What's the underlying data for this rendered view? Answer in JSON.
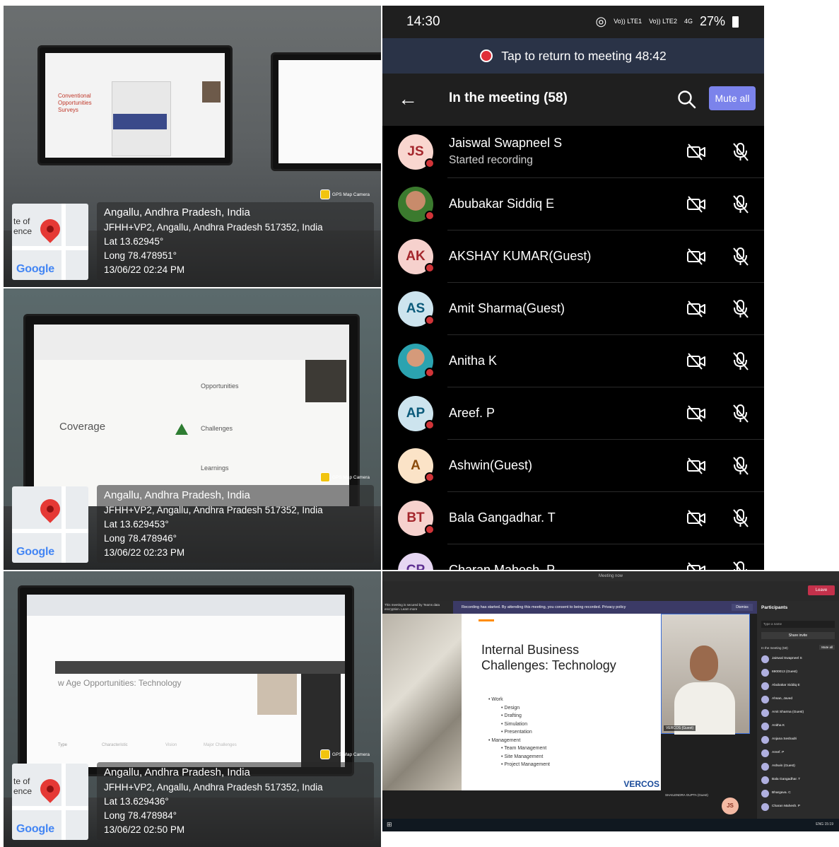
{
  "photos": [
    {
      "map_label_lines": [
        "te of",
        "ence"
      ],
      "map_brand": "Google",
      "gps_tag": "GPS Map Camera",
      "place": "Angallu, Andhra Pradesh, India",
      "address": "JFHH+VP2, Angallu, Andhra Pradesh 517352, India",
      "lat": "Lat 13.62945°",
      "long": "Long 78.478951°",
      "datetime": "13/06/22 02:24 PM",
      "screen_texts": [
        "Conventional",
        "Opportunities",
        "Surveys"
      ]
    },
    {
      "map_label_lines": [
        "",
        ""
      ],
      "map_brand": "Google",
      "gps_tag": "GPS Map Camera",
      "place": "Angallu, Andhra Pradesh, India",
      "address": "JFHH+VP2, Angallu, Andhra Pradesh 517352, India",
      "lat": "Lat 13.629453°",
      "long": "Long 78.478946°",
      "datetime": "13/06/22 02:23 PM",
      "screen_texts": [
        "Coverage",
        "Opportunities",
        "Challenges",
        "Learnings"
      ]
    },
    {
      "map_label_lines": [
        "te of",
        "ence"
      ],
      "map_brand": "Google",
      "gps_tag": "GPS Map Camera",
      "place": "Angallu, Andhra Pradesh, India",
      "address": "JFHH+VP2, Angallu, Andhra Pradesh 517352, India",
      "lat": "Lat 13.629436°",
      "long": "Long 78.478984°",
      "datetime": "13/06/22 02:50 PM",
      "screen_texts": [
        "w Age Opportunities: Technology",
        "Type",
        "Characteristic",
        "Vision",
        "Major Challenges"
      ]
    }
  ],
  "phone": {
    "time": "14:30",
    "battery": "27%",
    "network_labels": [
      "Vo)) LTE1",
      "Vo)) LTE2",
      "4G"
    ],
    "return_text": "Tap to return to meeting 48:42",
    "header_title": "In the meeting (58)",
    "mute_all": "Mute all",
    "participants": [
      {
        "initials": "JS",
        "name": "Jaiswal Swapneel S",
        "subtitle": "Started recording",
        "avatar_bg": "#f9d6cf",
        "avatar_fg": "#a4262c",
        "photo": false
      },
      {
        "initials": "",
        "name": "Abubakar Siddiq E",
        "subtitle": "",
        "avatar_bg": "#3b7a2e",
        "avatar_fg": "#ffffff",
        "photo": true
      },
      {
        "initials": "AK",
        "name": "AKSHAY KUMAR(Guest)",
        "subtitle": "",
        "avatar_bg": "#f6d1cd",
        "avatar_fg": "#a4262c",
        "photo": false
      },
      {
        "initials": "AS",
        "name": "Amit Sharma(Guest)",
        "subtitle": "",
        "avatar_bg": "#cde4ee",
        "avatar_fg": "#0b5a7a",
        "photo": false
      },
      {
        "initials": "",
        "name": "Anitha K",
        "subtitle": "",
        "avatar_bg": "#2ba3b0",
        "avatar_fg": "#ffffff",
        "photo": true
      },
      {
        "initials": "AP",
        "name": "Areef. P",
        "subtitle": "",
        "avatar_bg": "#cde4ee",
        "avatar_fg": "#0b5a7a",
        "photo": false
      },
      {
        "initials": "A",
        "name": "Ashwin(Guest)",
        "subtitle": "",
        "avatar_bg": "#fbe3c7",
        "avatar_fg": "#8a4b0b",
        "photo": false
      },
      {
        "initials": "BT",
        "name": "Bala Gangadhar. T",
        "subtitle": "",
        "avatar_bg": "#f6d1cd",
        "avatar_fg": "#a4262c",
        "photo": false
      },
      {
        "initials": "CP",
        "name": "Charan Mahesh. P",
        "subtitle": "",
        "avatar_bg": "#e6d6f2",
        "avatar_fg": "#5c2e91",
        "photo": false
      }
    ]
  },
  "desktop": {
    "window_title": "Meeting now",
    "leave": "Leave",
    "security_note": "This meeting is secured by Teams data encryption. Learn more",
    "recording_banner": "Recording has started. By attending this meeting, you consent to being recorded. Privacy policy",
    "dismiss": "Dismiss",
    "slide_title_1": "Internal Business",
    "slide_title_2": "Challenges: Technology",
    "slide_items": [
      {
        "text": "Work",
        "sub": false
      },
      {
        "text": "Design",
        "sub": true
      },
      {
        "text": "Drafting",
        "sub": true
      },
      {
        "text": "Simulation",
        "sub": true
      },
      {
        "text": "Presentation",
        "sub": true
      },
      {
        "text": "Management",
        "sub": false
      },
      {
        "text": "Team Management",
        "sub": true
      },
      {
        "text": "Site Management",
        "sub": true
      },
      {
        "text": "Project Management",
        "sub": true
      }
    ],
    "slide_brand": "VERCOS",
    "video_tag": "VERCOS (Guest)",
    "presenter_tag": "SHAILENDRA GUPTA (Guest)",
    "bottom_self": "JS",
    "panel_title": "Participants",
    "panel_search": "Type a name",
    "panel_share": "Share invite",
    "panel_in_meeting": "In the meeting (58)",
    "panel_mute": "Mute all",
    "panel_people": [
      "Jaiswal Swapneel S",
      "6900013 (Guest)",
      "Abubakar Siddiq E",
      "Ahsan, Javed",
      "Amit Sharma (Guest)",
      "Anitha K",
      "Anjana Seshadri",
      "Areef. P",
      "Ashwin (Guest)",
      "Bala Gangadhar. T",
      "Bhargava. C",
      "Charan Mahesh. P"
    ],
    "taskbar_right": "ENG 15:19"
  }
}
